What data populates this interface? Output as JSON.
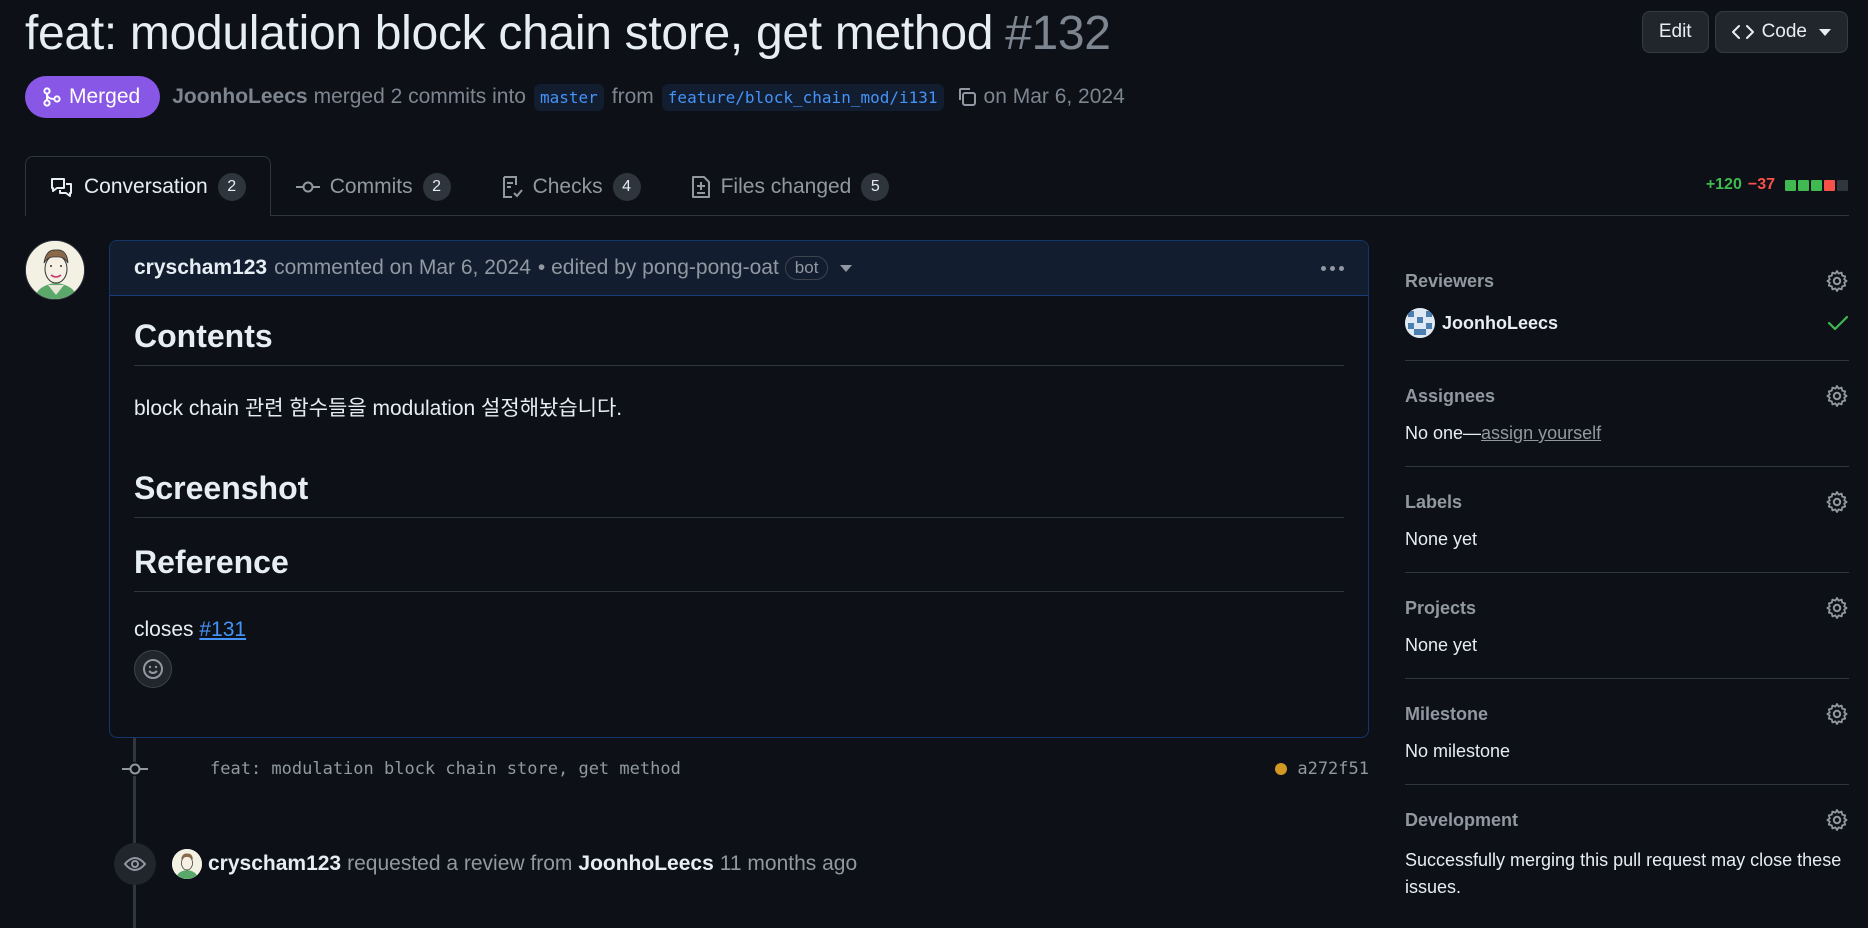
{
  "pr": {
    "title": "feat: modulation block chain store, get method",
    "number": "#132",
    "status": "Merged",
    "author": "JoonhoLeecs",
    "merge_text": "merged 2 commits into",
    "base_branch": "master",
    "from_text": "from",
    "head_branch": "feature/block_chain_mod/i131",
    "date_text": "on Mar 6, 2024"
  },
  "header_actions": {
    "edit_label": "Edit",
    "code_label": "Code"
  },
  "tabs": [
    {
      "label": "Conversation",
      "count": "2",
      "icon": "comment-discussion-icon"
    },
    {
      "label": "Commits",
      "count": "2",
      "icon": "git-commit-icon"
    },
    {
      "label": "Checks",
      "count": "4",
      "icon": "checklist-icon"
    },
    {
      "label": "Files changed",
      "count": "5",
      "icon": "file-diff-icon"
    }
  ],
  "diffstat": {
    "additions": "+120",
    "deletions": "−37",
    "colors": [
      "#3fb950",
      "#3fb950",
      "#3fb950",
      "#f85149",
      "#30363d"
    ]
  },
  "comment": {
    "author": "cryscham123",
    "action": "commented on Mar 6, 2024",
    "edited_text": "• edited by pong-pong-oat",
    "bot_label": "bot",
    "heading_contents": "Contents",
    "body_text": "block chain 관련 함수들을 modulation 설정해놨습니다.",
    "heading_screenshot": "Screenshot",
    "heading_reference": "Reference",
    "closes_text": "closes",
    "issue_link": "#131"
  },
  "commit": {
    "message": "feat: modulation block chain store, get method",
    "sha": "a272f51"
  },
  "review_event": {
    "actor": "cryscham123",
    "action": "requested a review from",
    "reviewer": "JoonhoLeecs",
    "time": "11 months ago"
  },
  "sidebar": {
    "reviewers": {
      "title": "Reviewers",
      "name": "JoonhoLeecs"
    },
    "assignees": {
      "title": "Assignees",
      "none": "No one—",
      "link": "assign yourself"
    },
    "labels": {
      "title": "Labels",
      "value": "None yet"
    },
    "projects": {
      "title": "Projects",
      "value": "None yet"
    },
    "milestone": {
      "title": "Milestone",
      "value": "No milestone"
    },
    "development": {
      "title": "Development",
      "value": "Successfully merging this pull request may close these issues."
    }
  }
}
